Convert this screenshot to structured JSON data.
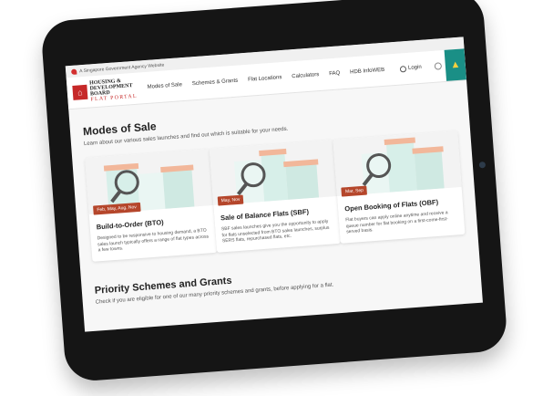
{
  "gov_bar": {
    "text": "A Singapore Government Agency Website"
  },
  "logo": {
    "line1": "HOUSING &",
    "line2": "DEVELOPMENT",
    "line3": "BOARD",
    "sub": "FLAT PORTAL"
  },
  "nav": {
    "links": [
      "Modes of Sale",
      "Schemes & Grants",
      "Flat Locations",
      "Calculators",
      "FAQ",
      "HDB InfoWEB"
    ],
    "login_label": "Login",
    "alert_icon": "warning-icon"
  },
  "main": {
    "heading": "Modes of Sale",
    "lead": "Learn about our various sales launches and find out which is suitable for your needs.",
    "cards": [
      {
        "badge": "Feb, May, Aug, Nov",
        "title": "Build-to-Order (BTO)",
        "desc": "Designed to be responsive to housing demand, a BTO sales launch typically offers a range of flat types across a few towns."
      },
      {
        "badge": "May, Nov",
        "title": "Sale of Balance Flats (SBF)",
        "desc": "SBF sales launches give you the opportunity to apply for flats unselected from BTO sales launches, surplus SERS flats, repurchased flats, etc."
      },
      {
        "badge": "Mar, Sep",
        "title": "Open Booking of Flats (OBF)",
        "desc": "Flat buyers can apply online anytime and receive a queue number for flat booking on a first-come-first-served basis."
      }
    ],
    "heading2": "Priority Schemes and Grants",
    "lead2": "Check if you are eligible for one of our many priority schemes and grants, before applying for a flat."
  },
  "colors": {
    "brand": "#c62828",
    "accent": "#1a8f86",
    "badge": "#b5462b"
  }
}
